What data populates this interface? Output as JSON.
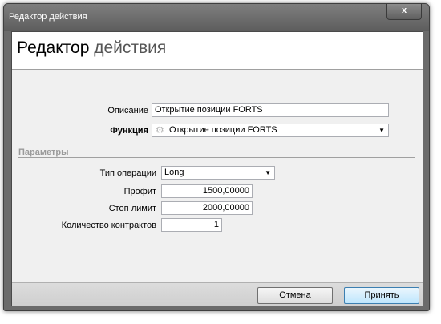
{
  "window": {
    "title": "Редактор действия",
    "close_label": "x"
  },
  "header": {
    "title_main": "Редактор",
    "title_rest": " действия"
  },
  "form": {
    "description_label": "Описание",
    "description_value": "Открытие позиции FORTS",
    "function_label": "Функция",
    "function_value": "Открытие позиции FORTS"
  },
  "params": {
    "group_label": "Параметры",
    "operation_type_label": "Тип операции",
    "operation_type_value": "Long",
    "profit_label": "Профит",
    "profit_value": "1500,00000",
    "stop_limit_label": "Стоп лимит",
    "stop_limit_value": "2000,00000",
    "contracts_label": "Количество контрактов",
    "contracts_value": "1"
  },
  "footer": {
    "cancel_label": "Отмена",
    "accept_label": "Принять"
  },
  "icons": {
    "dropdown_arrow": "chevron-down-icon",
    "function_icon": "gear-icon",
    "close": "close-icon"
  }
}
